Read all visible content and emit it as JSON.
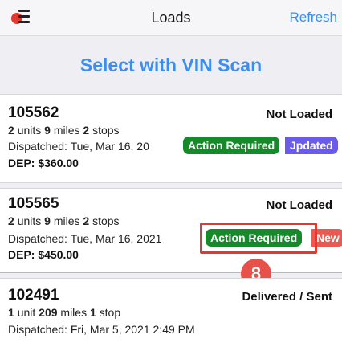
{
  "nav": {
    "title": "Loads",
    "refresh_label": "Refresh"
  },
  "vin_scan_label": "Select with VIN Scan",
  "loads": [
    {
      "id": "105562",
      "status": "Not Loaded",
      "units_count": "2",
      "units_label": "units",
      "miles_count": "9",
      "miles_label": "miles",
      "stops_count": "2",
      "stops_label": "stops",
      "dispatched": "Dispatched: Tue, Mar 16, 20",
      "dep": "DEP: $360.00",
      "badge_action": "Action Required",
      "badge_extra": "Jpdated"
    },
    {
      "id": "105565",
      "status": "Not Loaded",
      "units_count": "2",
      "units_label": "units",
      "miles_count": "9",
      "miles_label": "miles",
      "stops_count": "2",
      "stops_label": "stops",
      "dispatched": "Dispatched: Tue, Mar 16, 2021",
      "dep": "DEP: $450.00",
      "badge_action": "Action Required",
      "badge_extra": "New"
    },
    {
      "id": "102491",
      "status": "Delivered / Sent",
      "units_count": "1",
      "units_label": "unit",
      "miles_count": "209",
      "miles_label": "miles",
      "stops_count": "1",
      "stops_label": "stop",
      "dispatched": "Dispatched: Fri, Mar 5, 2021 2:49 PM"
    }
  ],
  "step_marker": "8",
  "colors": {
    "accent": "#3b8ef0",
    "action_green": "#168a2a",
    "updated_purple": "#6a5be8",
    "new_red": "#e95a52",
    "highlight_red": "#e2382f"
  }
}
